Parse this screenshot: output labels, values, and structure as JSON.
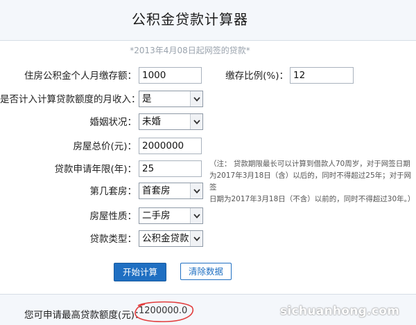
{
  "page": {
    "title": "公积金贷款计算器",
    "subtitle": "*2013年4月08日起网签的贷款*"
  },
  "form": {
    "monthly_deposit": {
      "label": "住房公积金个人月缴存额：",
      "value": "1000"
    },
    "deposit_ratio": {
      "label": "缴存比例(%)：",
      "value": "12"
    },
    "count_income": {
      "label": "是否计入计算贷款额度的月收入：",
      "value": "是"
    },
    "marital_status": {
      "label": "婚姻状况：",
      "value": "未婚"
    },
    "house_price": {
      "label": "房屋总价(元)：",
      "value": "2000000"
    },
    "loan_years": {
      "label": "贷款申请年限(年)：",
      "value": "25"
    },
    "house_count": {
      "label": "第几套房：",
      "value": "首套房"
    },
    "house_type": {
      "label": "房屋性质：",
      "value": "二手房"
    },
    "loan_type": {
      "label": "贷款类型：",
      "value": "公积金贷款"
    }
  },
  "note": {
    "lines": [
      "（注：  贷款期限最长可以计算到借款人70周岁，对于网签日期",
      "为2017年3月18日（含）以后的，同时不得超过25年；对于网签",
      "日期为2017年3月18日（不含）以前的，同时不得超过30年。）"
    ]
  },
  "actions": {
    "calculate_label": "开始计算",
    "clear_label": "清除数据"
  },
  "result": {
    "label": "您可申请最高贷款额度(元)：",
    "value": "1200000.0"
  },
  "watermark": "sichuanhong.com",
  "colors": {
    "primary": "#1f6fc2",
    "header_bg": "#f4f7fb",
    "annotation_red": "#e23b3b"
  },
  "icons": {
    "select_arrow": "chevron-down-icon"
  }
}
